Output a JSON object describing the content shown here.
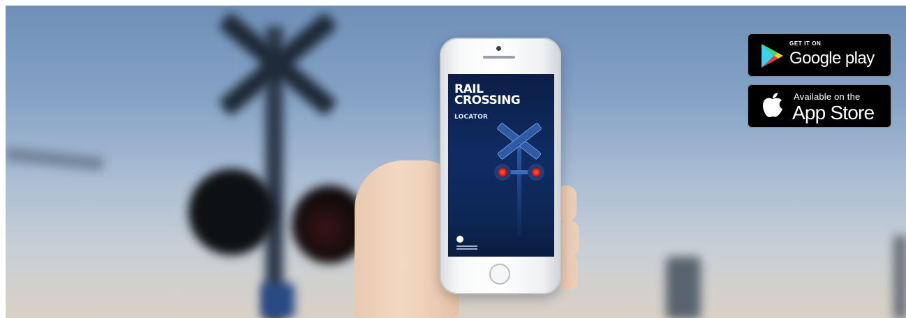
{
  "app_screen": {
    "title_line1": "RAIL",
    "title_line2": "CROSSING",
    "subtitle": "LOCATOR"
  },
  "badges": {
    "google": {
      "small_label": "GET IT ON",
      "large_label": "Google play",
      "icon": "google-play-icon"
    },
    "apple": {
      "small_label": "Available on the",
      "large_label": "App Store",
      "icon": "apple-icon"
    }
  },
  "colors": {
    "badge_background": "#000000",
    "screen_background": "#0f2c63",
    "signal_red": "#e0281f"
  }
}
